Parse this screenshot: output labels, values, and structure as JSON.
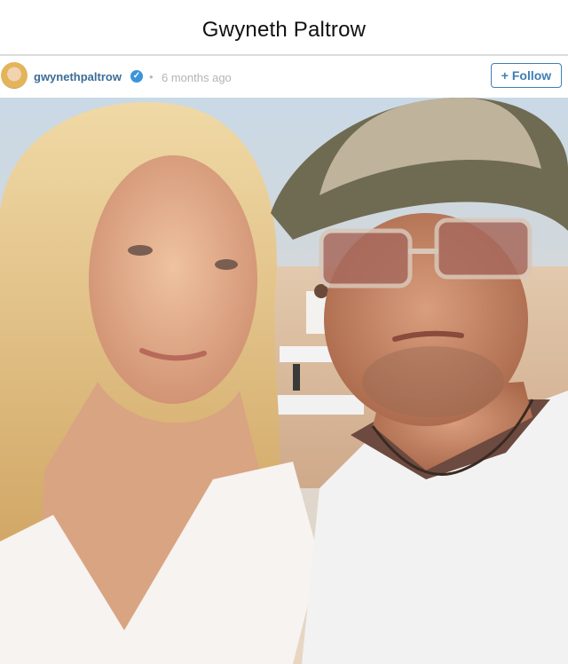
{
  "page": {
    "title": "Gwyneth Paltrow"
  },
  "post": {
    "username": "gwynethpaltrow",
    "verified_icon": "verified-badge-icon",
    "separator": "•",
    "timestamp": "6 months ago",
    "follow_label": "+ Follow"
  },
  "colors": {
    "username": "#3b6d97",
    "verified": "#3b94d9",
    "follow_border": "#3f7fb4",
    "muted": "#b4b4b4"
  }
}
